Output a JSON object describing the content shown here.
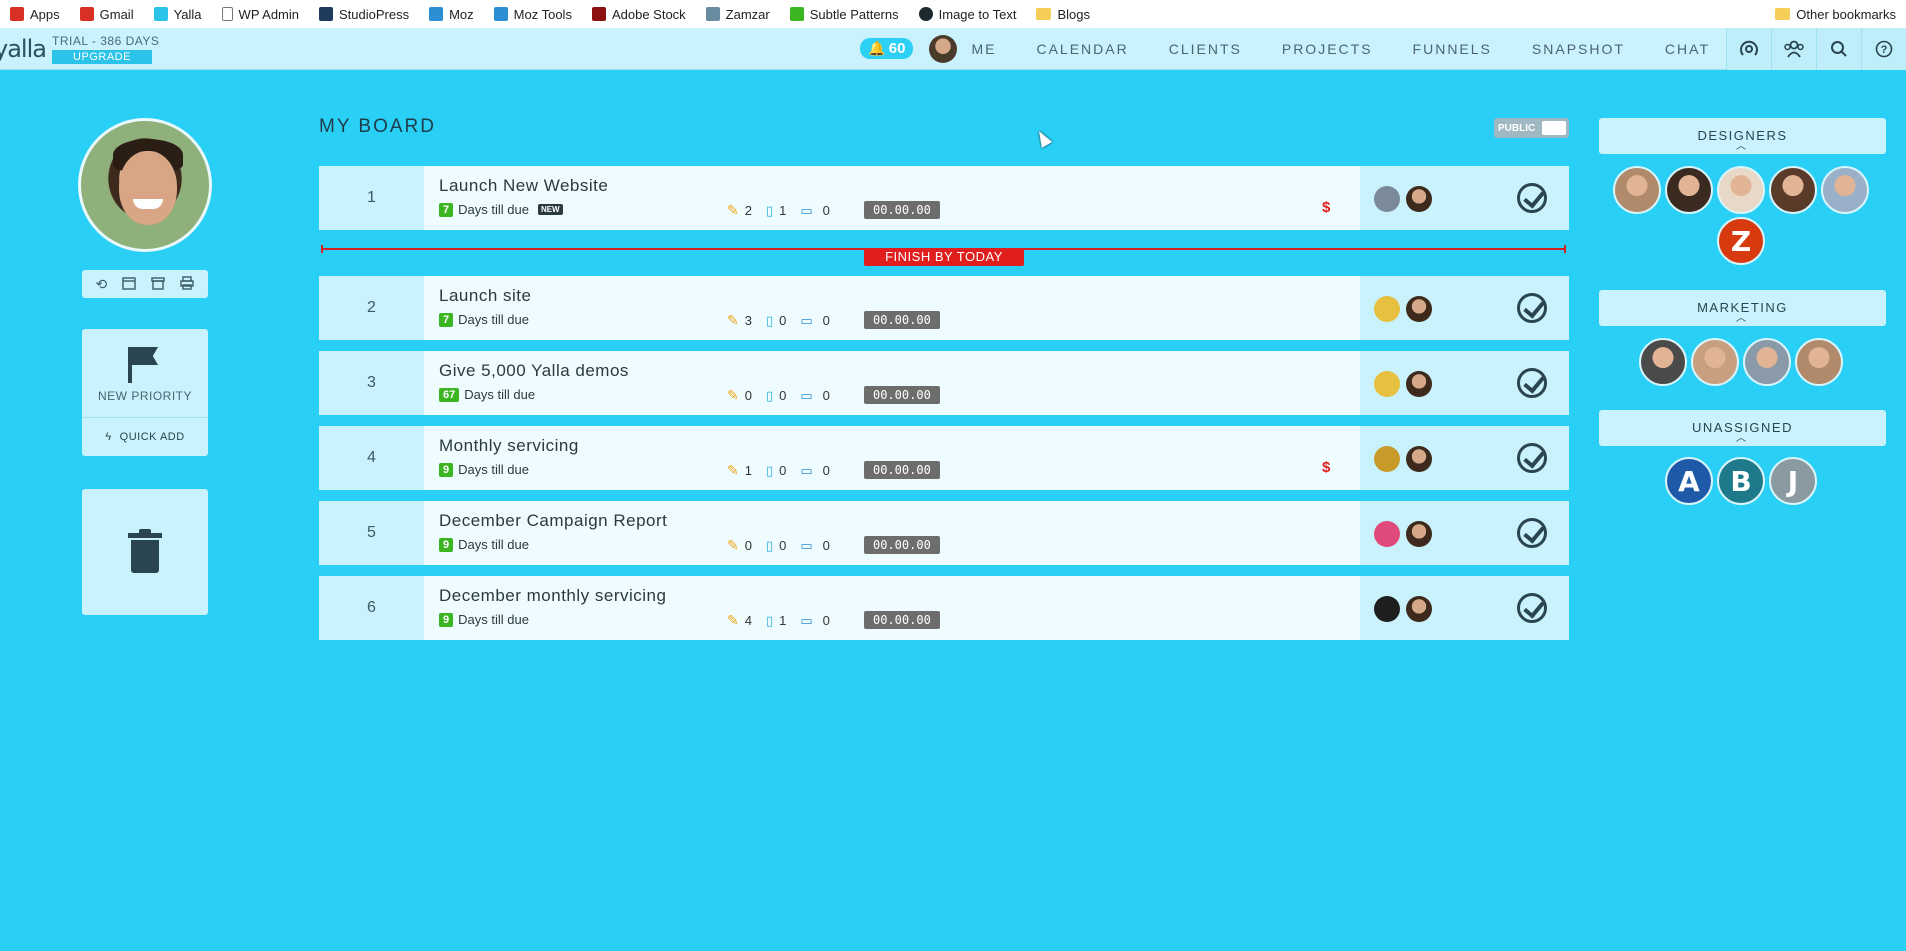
{
  "bookmarks": {
    "items": [
      {
        "label": "Apps",
        "icon": "apps-grid-icon",
        "color": "#d93025"
      },
      {
        "label": "Gmail",
        "icon": "gmail-icon",
        "color": "#d93025"
      },
      {
        "label": "Yalla",
        "icon": "yalla-icon",
        "color": "#2bc3e8"
      },
      {
        "label": "WP Admin",
        "icon": "page-icon",
        "color": "#777777"
      },
      {
        "label": "StudioPress",
        "icon": "studiopress-icon",
        "color": "#1e3a5c"
      },
      {
        "label": "Moz",
        "icon": "moz-icon",
        "color": "#2b8fd4"
      },
      {
        "label": "Moz Tools",
        "icon": "moz-icon",
        "color": "#2b8fd4"
      },
      {
        "label": "Adobe Stock",
        "icon": "adobe-stock-icon",
        "color": "#8b1010"
      },
      {
        "label": "Zamzar",
        "icon": "zamzar-icon",
        "color": "#6a8ca0"
      },
      {
        "label": "Subtle Patterns",
        "icon": "subtle-patterns-icon",
        "color": "#3cb522"
      },
      {
        "label": "Image to Text",
        "icon": "image-to-text-icon",
        "color": "#1e2a30"
      },
      {
        "label": "Blogs",
        "icon": "folder-icon",
        "color": "#f5cd57"
      }
    ],
    "other": "Other bookmarks"
  },
  "topnav": {
    "logo": "yalla",
    "trial": "TRIAL - 386 DAYS",
    "upgrade": "UPGRADE",
    "notifications": "60",
    "items": [
      "ME",
      "CALENDAR",
      "CLIENTS",
      "PROJECTS",
      "FUNNELS",
      "SNAPSHOT",
      "CHAT"
    ],
    "icons": [
      "broadcast-icon",
      "team-icon",
      "search-icon",
      "help-icon"
    ]
  },
  "sidebar": {
    "new_priority": "NEW PRIORITY",
    "quick_add": "QUICK ADD",
    "tools": [
      "history-icon",
      "calendar-icon",
      "archive-icon",
      "print-icon"
    ]
  },
  "board": {
    "title": "MY BOARD",
    "visibility": "PUBLIC",
    "finish_label": "FINISH BY TODAY",
    "due_text": "Days till due",
    "new_tag": "NEW",
    "rows": [
      {
        "num": "1",
        "title": "Launch New Website",
        "days": "7",
        "is_new": true,
        "pins": "2",
        "files": "1",
        "comments": "0",
        "timer": "00.00.00",
        "overdue_billing": true,
        "client_color": "#7a8a9a"
      },
      {
        "num": "2",
        "title": "Launch site",
        "days": "7",
        "is_new": false,
        "pins": "3",
        "files": "0",
        "comments": "0",
        "timer": "00.00.00",
        "overdue_billing": false,
        "client_color": "#e8c040"
      },
      {
        "num": "3",
        "title": "Give 5,000 Yalla demos",
        "days": "67",
        "is_new": false,
        "pins": "0",
        "files": "0",
        "comments": "0",
        "timer": "00.00.00",
        "overdue_billing": false,
        "client_color": "#e8c040"
      },
      {
        "num": "4",
        "title": "Monthly servicing",
        "days": "9",
        "is_new": false,
        "pins": "1",
        "files": "0",
        "comments": "0",
        "timer": "00.00.00",
        "overdue_billing": true,
        "client_color": "#c89a2a"
      },
      {
        "num": "5",
        "title": "December Campaign Report",
        "days": "9",
        "is_new": false,
        "pins": "0",
        "files": "0",
        "comments": "0",
        "timer": "00.00.00",
        "overdue_billing": false,
        "client_color": "#e04a7a"
      },
      {
        "num": "6",
        "title": "December monthly servicing",
        "days": "9",
        "is_new": false,
        "pins": "4",
        "files": "1",
        "comments": "0",
        "timer": "00.00.00",
        "overdue_billing": false,
        "client_color": "#1e1e1e"
      }
    ]
  },
  "teams": {
    "designers": {
      "label": "DESIGNERS",
      "members": [
        {
          "color": "#b08a6a"
        },
        {
          "color": "#3a2a20"
        },
        {
          "color": "#e8d8c8"
        },
        {
          "color": "#5a3a28"
        },
        {
          "color": "#9ab0c8"
        }
      ],
      "letter_members": [
        {
          "letter": "Z",
          "color": "#d83a10"
        }
      ]
    },
    "marketing": {
      "label": "MARKETING",
      "members": [
        {
          "color": "#4a4a4a"
        },
        {
          "color": "#c8a080"
        },
        {
          "color": "#8a9aa8"
        },
        {
          "color": "#b08a6a"
        }
      ]
    },
    "unassigned": {
      "label": "UNASSIGNED",
      "letter_members": [
        {
          "letter": "A",
          "color": "#1e5aa8"
        },
        {
          "letter": "B",
          "color": "#1e7a8a"
        },
        {
          "letter": "J",
          "color": "#8a9aa0"
        }
      ]
    }
  }
}
